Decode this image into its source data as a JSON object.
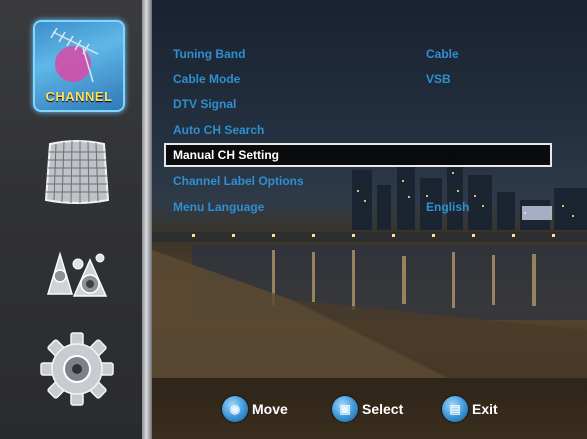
{
  "rail": {
    "items": [
      {
        "name": "channel",
        "label": "CHANNEL",
        "active": true
      },
      {
        "name": "picture",
        "label": "",
        "active": false
      },
      {
        "name": "audio",
        "label": "",
        "active": false
      },
      {
        "name": "setup",
        "label": "",
        "active": false
      }
    ]
  },
  "menu": {
    "items": [
      {
        "label": "Tuning Band",
        "value": "Cable"
      },
      {
        "label": "Cable Mode",
        "value": "VSB"
      },
      {
        "label": "DTV Signal",
        "value": ""
      },
      {
        "label": "Auto CH Search",
        "value": ""
      },
      {
        "label": "Manual CH Setting",
        "value": "",
        "selected": true
      },
      {
        "label": "Channel Label Options",
        "value": ""
      },
      {
        "label": "Menu Language",
        "value": "English"
      }
    ]
  },
  "hints": [
    {
      "icon": "move-icon",
      "label": "Move"
    },
    {
      "icon": "select-icon",
      "label": "Select"
    },
    {
      "icon": "exit-icon",
      "label": "Exit"
    }
  ],
  "colors": {
    "accent": "#2f8fd0",
    "selected_text": "#ffffff",
    "channel_label": "#ffe15a"
  }
}
